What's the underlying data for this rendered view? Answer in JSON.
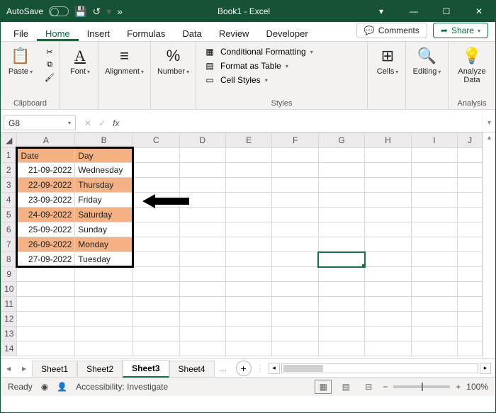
{
  "titlebar": {
    "autosave_label": "AutoSave",
    "autosave_state": "Off",
    "title": "Book1 - Excel"
  },
  "tabs": {
    "file": "File",
    "home": "Home",
    "insert": "Insert",
    "formulas": "Formulas",
    "data": "Data",
    "review": "Review",
    "developer": "Developer",
    "comments": "Comments",
    "share": "Share"
  },
  "ribbon": {
    "clipboard_group": "Clipboard",
    "paste": "Paste",
    "font": "Font",
    "alignment": "Alignment",
    "number": "Number",
    "styles_group": "Styles",
    "cond_fmt": "Conditional Formatting",
    "fmt_table": "Format as Table",
    "cell_styles": "Cell Styles",
    "cells": "Cells",
    "editing": "Editing",
    "analyze": "Analyze Data",
    "analysis_group": "Analysis"
  },
  "formula_bar": {
    "name_box": "G8",
    "fx_label": "fx",
    "value": ""
  },
  "grid": {
    "columns": [
      "A",
      "B",
      "C",
      "D",
      "E",
      "F",
      "G",
      "H",
      "I",
      "J"
    ],
    "row_count": 14,
    "selected_cell": "G8",
    "data": {
      "A1": "Date",
      "B1": "Day",
      "A2": "21-09-2022",
      "B2": "Wednesday",
      "A3": "22-09-2022",
      "B3": "Thursday",
      "A4": "23-09-2022",
      "B4": "Friday",
      "A5": "24-09-2022",
      "B5": "Saturday",
      "A6": "25-09-2022",
      "B6": "Sunday",
      "A7": "26-09-2022",
      "B7": "Monday",
      "A8": "27-09-2022",
      "B8": "Tuesday"
    },
    "highlights": [
      "A1",
      "B1",
      "A3",
      "B3",
      "A5",
      "B5",
      "A7",
      "B7"
    ]
  },
  "sheets": {
    "s1": "Sheet1",
    "s2": "Sheet2",
    "s3": "Sheet3",
    "s4": "Sheet4",
    "active": "Sheet3"
  },
  "status": {
    "ready": "Ready",
    "accessibility": "Accessibility: Investigate",
    "zoom": "100%"
  }
}
